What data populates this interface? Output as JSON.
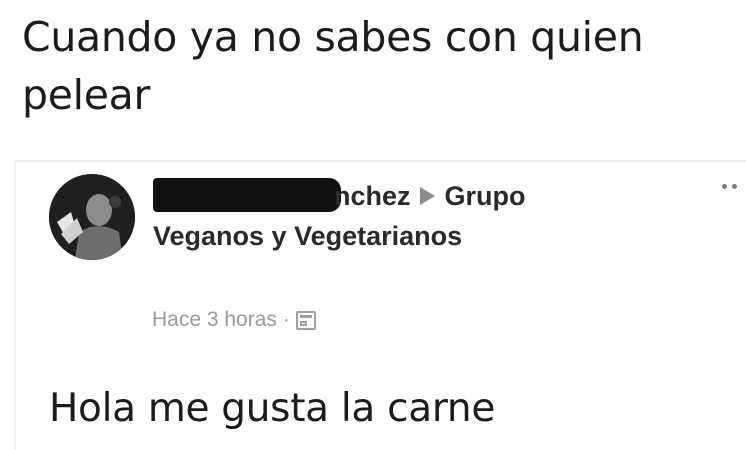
{
  "caption": {
    "text": "Cuando ya no sabes con quien pelear"
  },
  "post": {
    "author_visible_fragment": "nchez",
    "group_prefix": "Grupo",
    "group_name": "Veganos y Vegetarianos",
    "timestamp": "Hace 3 horas",
    "separator": "·",
    "privacy_icon": "calendar-privacy-icon",
    "body": "Hola me gusta la carne",
    "more_icon": "more-options-icon"
  },
  "colors": {
    "text": "#1c1c1c",
    "meta": "#9a9a9a",
    "redaction": "#111111"
  }
}
